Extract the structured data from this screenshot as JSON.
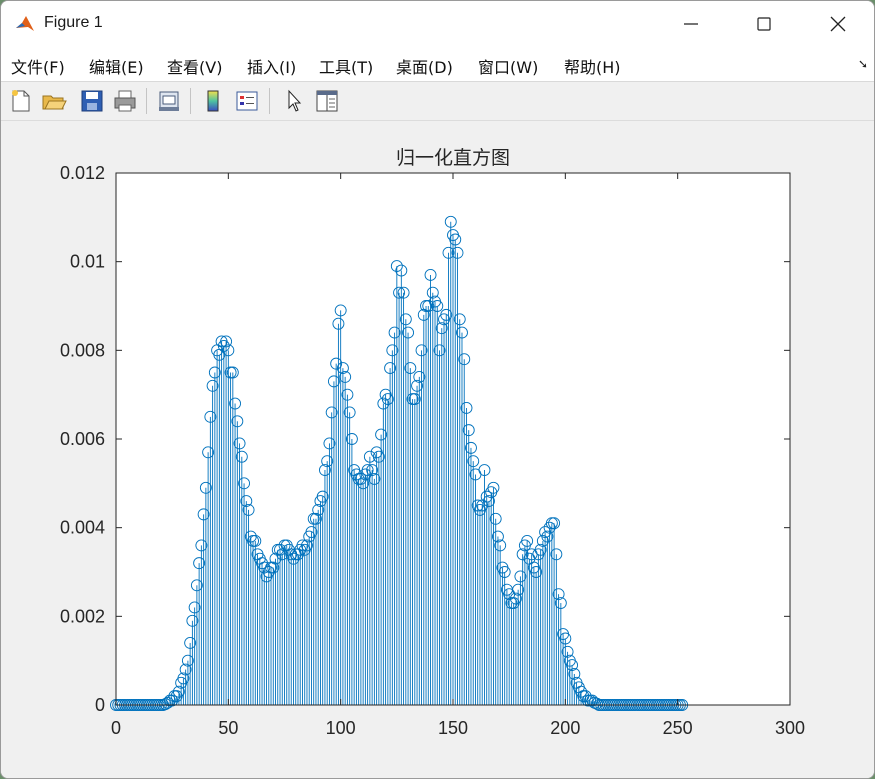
{
  "window": {
    "title": "Figure 1"
  },
  "menu": [
    {
      "label": "文件(F)"
    },
    {
      "label": "编辑(E)"
    },
    {
      "label": "查看(V)"
    },
    {
      "label": "插入(I)"
    },
    {
      "label": "工具(T)"
    },
    {
      "label": "桌面(D)"
    },
    {
      "label": "窗口(W)"
    },
    {
      "label": "帮助(H)"
    }
  ],
  "toolbar": [
    "new-figure-icon",
    "open-file-icon",
    "save-icon",
    "print-icon",
    "print-preview-icon",
    "colorbar-icon",
    "legend-icon",
    "pointer-icon",
    "property-inspector-icon"
  ],
  "colors": {
    "stem": "#0072bd",
    "axes": "#262626",
    "plot_bg": "#ffffff",
    "figure_bg": "#f0f0f0"
  },
  "chart_data": {
    "type": "stem",
    "title": "归一化直方图",
    "xlabel": "",
    "ylabel": "",
    "xlim": [
      0,
      300
    ],
    "ylim": [
      0,
      0.012
    ],
    "xticks": [
      0,
      50,
      100,
      150,
      200,
      250,
      300
    ],
    "xtick_labels": [
      "0",
      "50",
      "100",
      "150",
      "200",
      "250",
      "300"
    ],
    "yticks": [
      0,
      0.002,
      0.004,
      0.006,
      0.008,
      0.01,
      0.012
    ],
    "ytick_labels": [
      "0",
      "0.002",
      "0.004",
      "0.006",
      "0.008",
      "0.01",
      "0.012"
    ],
    "grid": false,
    "marker": "circle",
    "x_start": 0,
    "x_step": 1,
    "values": [
      0,
      0,
      0,
      0,
      0,
      0,
      0,
      0,
      0,
      0,
      0,
      0,
      0,
      0,
      0,
      0,
      0,
      0,
      0,
      0,
      0,
      0,
      2e-05,
      5e-05,
      0.0001,
      0.0001,
      0.0002,
      0.0002,
      0.0003,
      0.0005,
      0.0006,
      0.0008,
      0.001,
      0.0014,
      0.0019,
      0.0022,
      0.0027,
      0.0032,
      0.0036,
      0.0043,
      0.0049,
      0.0057,
      0.0065,
      0.0072,
      0.0075,
      0.008,
      0.0079,
      0.0082,
      0.0081,
      0.0082,
      0.008,
      0.0075,
      0.0075,
      0.0068,
      0.0064,
      0.0059,
      0.0056,
      0.005,
      0.0046,
      0.0044,
      0.0038,
      0.0037,
      0.0037,
      0.0034,
      0.0033,
      0.0032,
      0.0031,
      0.0029,
      0.003,
      0.0031,
      0.0031,
      0.0033,
      0.0035,
      0.0035,
      0.0034,
      0.0036,
      0.0036,
      0.0035,
      0.0034,
      0.0033,
      0.0034,
      0.0034,
      0.0035,
      0.0036,
      0.0035,
      0.0036,
      0.0038,
      0.0039,
      0.0042,
      0.0042,
      0.0044,
      0.0046,
      0.0047,
      0.0053,
      0.0055,
      0.0059,
      0.0066,
      0.0073,
      0.0077,
      0.0086,
      0.0089,
      0.0076,
      0.0074,
      0.007,
      0.0066,
      0.006,
      0.0053,
      0.0052,
      0.0051,
      0.0051,
      0.005,
      0.0052,
      0.0053,
      0.0056,
      0.0053,
      0.0051,
      0.0057,
      0.0056,
      0.0061,
      0.0068,
      0.007,
      0.0069,
      0.0076,
      0.008,
      0.0084,
      0.0099,
      0.0093,
      0.0098,
      0.0093,
      0.0087,
      0.0084,
      0.0076,
      0.0069,
      0.0069,
      0.0072,
      0.0074,
      0.008,
      0.0088,
      0.009,
      0.009,
      0.0097,
      0.0093,
      0.0091,
      0.009,
      0.008,
      0.0085,
      0.0087,
      0.0088,
      0.0102,
      0.0109,
      0.0106,
      0.0105,
      0.0102,
      0.0087,
      0.0084,
      0.0078,
      0.0067,
      0.0062,
      0.0058,
      0.0055,
      0.0052,
      0.0045,
      0.0044,
      0.0045,
      0.0053,
      0.0047,
      0.0046,
      0.0048,
      0.0049,
      0.0042,
      0.0038,
      0.0036,
      0.0031,
      0.003,
      0.0026,
      0.0025,
      0.0023,
      0.0023,
      0.0024,
      0.0026,
      0.0029,
      0.0034,
      0.0036,
      0.0037,
      0.0033,
      0.0034,
      0.0031,
      0.003,
      0.0034,
      0.0035,
      0.0037,
      0.0039,
      0.0038,
      0.004,
      0.0041,
      0.0041,
      0.0034,
      0.0025,
      0.0023,
      0.0016,
      0.0015,
      0.0012,
      0.001,
      0.0009,
      0.0007,
      0.0005,
      0.0004,
      0.0003,
      0.0002,
      0.0002,
      0.0001,
      0.0001,
      0.0001,
      5e-05,
      3e-05,
      0,
      0,
      0,
      0,
      0,
      0,
      0,
      0,
      0,
      0,
      0,
      0,
      0,
      0,
      0,
      0,
      0,
      0,
      0,
      0,
      0,
      0,
      0,
      0,
      0,
      0,
      0,
      0,
      0,
      0,
      0,
      0,
      0,
      0,
      0,
      0,
      0,
      0
    ]
  }
}
